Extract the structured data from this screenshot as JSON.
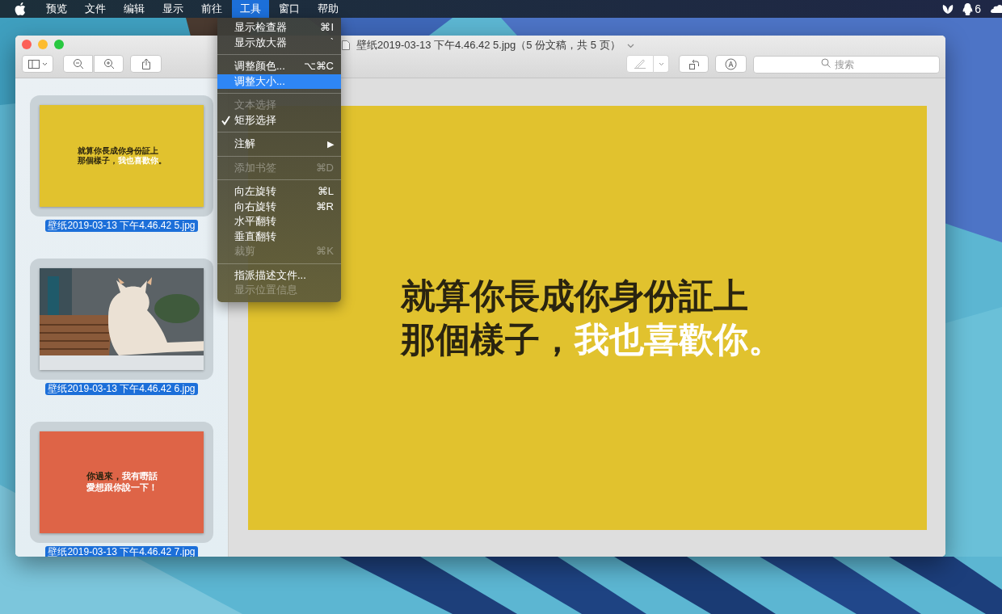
{
  "menubar": {
    "items": [
      {
        "label": "预览",
        "selected": false
      },
      {
        "label": "文件",
        "selected": false
      },
      {
        "label": "编辑",
        "selected": false
      },
      {
        "label": "显示",
        "selected": false
      },
      {
        "label": "前往",
        "selected": false
      },
      {
        "label": "工具",
        "selected": true
      },
      {
        "label": "窗口",
        "selected": false
      },
      {
        "label": "帮助",
        "selected": false
      }
    ],
    "notification_count": "6"
  },
  "menu": {
    "items": [
      {
        "kind": "item",
        "label": "显示检查器",
        "shortcut": "⌘I",
        "disabled": false,
        "checked": false,
        "selected": false
      },
      {
        "kind": "item",
        "label": "显示放大器",
        "shortcut": "`",
        "disabled": false,
        "checked": false,
        "selected": false
      },
      {
        "kind": "separator"
      },
      {
        "kind": "item",
        "label": "调整颜色...",
        "shortcut": "⌥⌘C",
        "disabled": false,
        "checked": false,
        "selected": false
      },
      {
        "kind": "item",
        "label": "调整大小...",
        "disabled": false,
        "checked": false,
        "selected": true
      },
      {
        "kind": "separator"
      },
      {
        "kind": "item",
        "label": "文本选择",
        "disabled": true,
        "checked": false,
        "selected": false
      },
      {
        "kind": "item",
        "label": "矩形选择",
        "disabled": false,
        "checked": true,
        "selected": false
      },
      {
        "kind": "separator"
      },
      {
        "kind": "item",
        "label": "注解",
        "submenu": "▶",
        "disabled": false,
        "checked": false,
        "selected": false
      },
      {
        "kind": "separator"
      },
      {
        "kind": "item",
        "label": "添加书签",
        "shortcut": "⌘D",
        "disabled": true,
        "checked": false,
        "selected": false
      },
      {
        "kind": "separator"
      },
      {
        "kind": "item",
        "label": "向左旋转",
        "shortcut": "⌘L",
        "disabled": false,
        "checked": false,
        "selected": false
      },
      {
        "kind": "item",
        "label": "向右旋转",
        "shortcut": "⌘R",
        "disabled": false,
        "checked": false,
        "selected": false
      },
      {
        "kind": "item",
        "label": "水平翻转",
        "disabled": false,
        "checked": false,
        "selected": false
      },
      {
        "kind": "item",
        "label": "垂直翻转",
        "disabled": false,
        "checked": false,
        "selected": false
      },
      {
        "kind": "item",
        "label": "裁剪",
        "shortcut": "⌘K",
        "disabled": true,
        "checked": false,
        "selected": false
      },
      {
        "kind": "separator"
      },
      {
        "kind": "item",
        "label": "指派描述文件...",
        "disabled": false,
        "checked": false,
        "selected": false
      },
      {
        "kind": "item",
        "label": "显示位置信息",
        "disabled": true,
        "checked": false,
        "selected": false
      }
    ]
  },
  "window": {
    "title": "壁纸2019-03-13 下午4.46.42 5.jpg（5 份文稿，共 5 页）",
    "search": {
      "placeholder": "搜索"
    }
  },
  "sidebar": {
    "thumbnails": [
      {
        "kind": "yellow",
        "caption": "壁纸2019-03-13 下午4.46.42 5.jpg",
        "selected": true,
        "lines": [
          [
            {
              "text": "就算你長成你身份証上",
              "highlighted": false
            }
          ],
          [
            {
              "text": "那個樣子，",
              "highlighted": false
            },
            {
              "text": "我也喜歡你",
              "highlighted": true
            },
            {
              "text": "。",
              "highlighted": false
            }
          ]
        ]
      },
      {
        "caption": "壁纸2019-03-13 下午4.46.42 6.jpg",
        "selected": true
      },
      {
        "kind": "red",
        "caption": "壁纸2019-03-13 下午4.46.42 7.jpg",
        "selected": true,
        "lines": [
          [
            {
              "text": "你過來，",
              "highlighted": false
            },
            {
              "text": "我有嘢話",
              "highlighted": true
            }
          ],
          [
            {
              "text": "愛想跟你說一下！",
              "highlighted": true
            }
          ]
        ]
      }
    ]
  },
  "document": {
    "lines": [
      [
        {
          "text": "就算你長成你身份証上",
          "highlighted": false
        }
      ],
      [
        {
          "text": "那個樣子，",
          "highlighted": false
        },
        {
          "text": "我也喜歡你",
          "highlighted": true
        },
        {
          "text": "。",
          "highlighted": true
        }
      ]
    ]
  }
}
